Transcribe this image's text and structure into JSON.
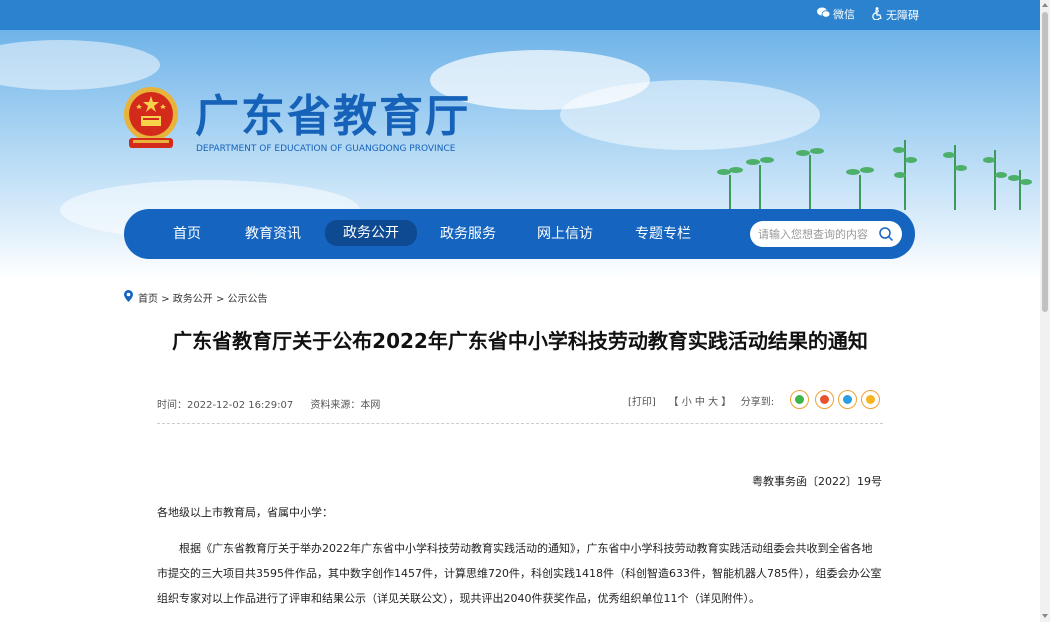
{
  "topbar": {
    "wechat_label": "微信",
    "accessibility_label": "无障碍"
  },
  "header": {
    "title": "广东省教育厅",
    "subtitle": "DEPARTMENT OF EDUCATION OF GUANGDONG PROVINCE"
  },
  "nav": {
    "items": [
      {
        "label": "首页"
      },
      {
        "label": "教育资讯"
      },
      {
        "label": "政务公开"
      },
      {
        "label": "政务服务"
      },
      {
        "label": "网上信访"
      },
      {
        "label": "专题专栏"
      }
    ],
    "active_index": 2,
    "search_placeholder": "请输入您想查询的内容"
  },
  "breadcrumb": {
    "home": "首页",
    "level1": "政务公开",
    "level2": "公示公告",
    "sep": ">"
  },
  "article": {
    "title": "广东省教育厅关于公布2022年广东省中小学科技劳动教育实践活动结果的通知",
    "time": "时间：2022-12-02 16:29:07",
    "source": "资料来源：本网",
    "print": "[打印]",
    "font_sizes": "【 小  中  大 】",
    "share_label": "分享到:",
    "doc_number": "粤教事务函〔2022〕19号",
    "salutation": "各地级以上市教育局，省属中小学：",
    "paragraph1": "根据《广东省教育厅关于举办2022年广东省中小学科技劳动教育实践活动的通知》，广东省中小学科技劳动教育实践活动组委会共收到全省各地市提交的三大项目共3595件作品，其中数字创作1457件，计算思维720件，科创实践1418件（科创智造633件，智能机器人785件），组委会办公室组织专家对以上作品进行了评审和结果公示（详见关联公文），现共评出2040件获奖作品，优秀组织单位11个（详见附件）。"
  },
  "colors": {
    "topbar": "#2b83cf",
    "brand_blue": "#1662b9",
    "nav": "#1565c0",
    "nav_active": "#0d4a92"
  }
}
